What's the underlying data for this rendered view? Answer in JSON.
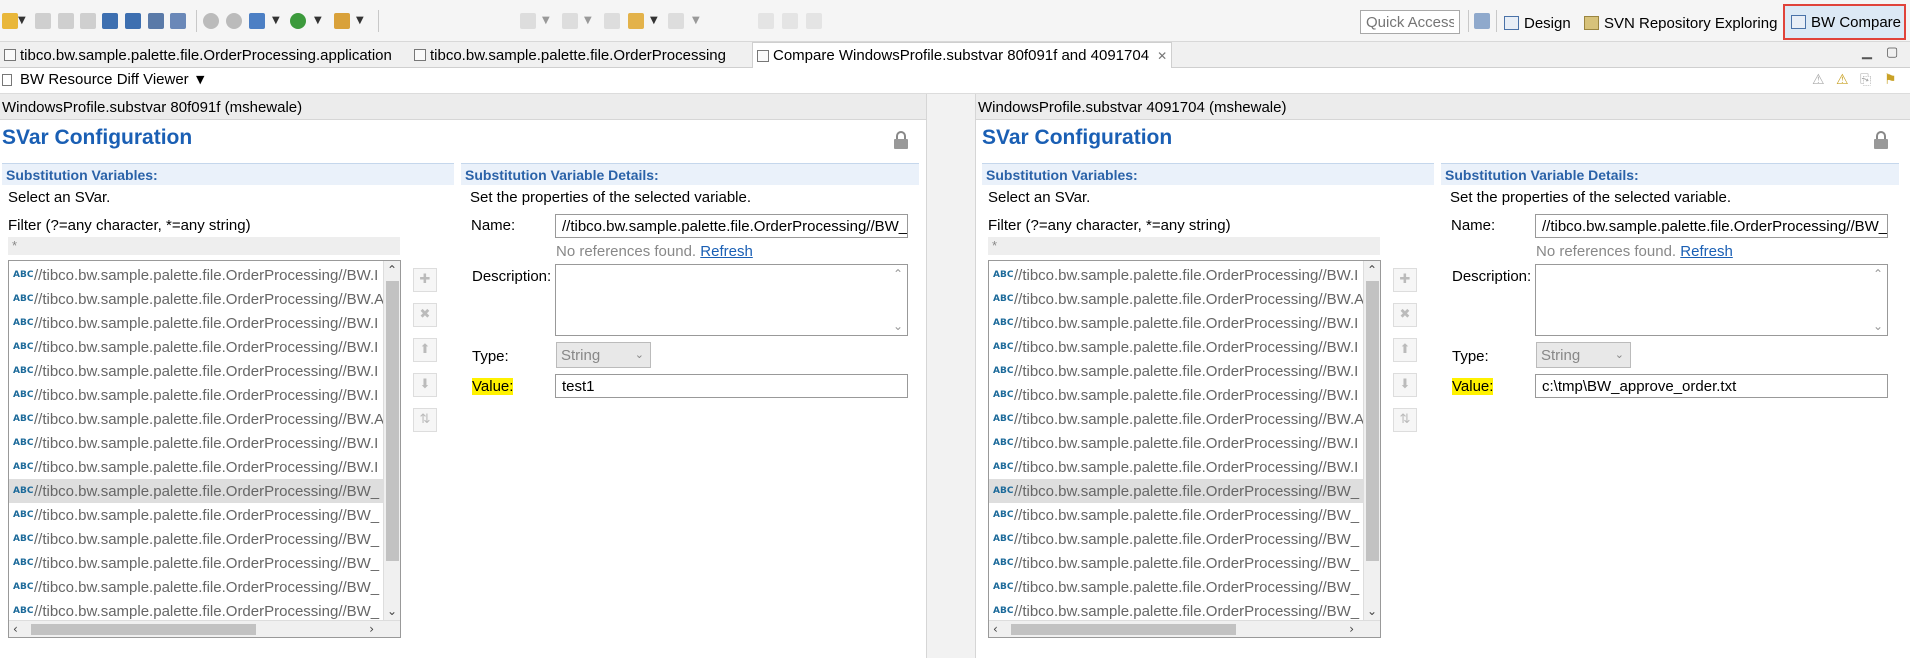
{
  "toolbar": {
    "quick_access_placeholder": "Quick Access",
    "perspectives": [
      {
        "label": "Design",
        "icon": "design-perspective-icon"
      },
      {
        "label": "SVN Repository Exploring",
        "icon": "svn-perspective-icon"
      },
      {
        "label": "BW Compare",
        "icon": "compare-perspective-icon",
        "selected": true
      }
    ],
    "icons": [
      "new-icon",
      "save-icon",
      "save-all-icon",
      "print-icon",
      "new-module-icon",
      "deploy-icon",
      "debug-icon",
      "run-icon",
      "settings-icon",
      "gear-icon",
      "palette-icon",
      "run-app-icon",
      "tools-icon",
      "nav-back-icon",
      "nav-forward-icon"
    ]
  },
  "editor_tabs": [
    {
      "label": "tibco.bw.sample.palette.file.OrderProcessing.application"
    },
    {
      "label": "tibco.bw.sample.palette.file.OrderProcessing"
    },
    {
      "label": "Compare WindowsProfile.substvar 80f091f and 4091704",
      "active": true,
      "close": "✕"
    }
  ],
  "viewer": {
    "title": "BW Resource Diff Viewer"
  },
  "panes": [
    {
      "header": "WindowsProfile.substvar 80f091f (mshewale)",
      "title": "SVar Configuration",
      "subst_vars_heading": "Substitution Variables:",
      "select_hint": "Select an SVar.",
      "filter_label": "Filter (?=any character, *=any string)",
      "filter_value": "*",
      "list": [
        "//tibco.bw.sample.palette.file.OrderProcessing//BW.I",
        "//tibco.bw.sample.palette.file.OrderProcessing//BW.A",
        "//tibco.bw.sample.palette.file.OrderProcessing//BW.I",
        "//tibco.bw.sample.palette.file.OrderProcessing//BW.I",
        "//tibco.bw.sample.palette.file.OrderProcessing//BW.I",
        "//tibco.bw.sample.palette.file.OrderProcessing//BW.I",
        "//tibco.bw.sample.palette.file.OrderProcessing//BW.A",
        "//tibco.bw.sample.palette.file.OrderProcessing//BW.I",
        "//tibco.bw.sample.palette.file.OrderProcessing//BW.I",
        "//tibco.bw.sample.palette.file.OrderProcessing//BW_",
        "//tibco.bw.sample.palette.file.OrderProcessing//BW_",
        "//tibco.bw.sample.palette.file.OrderProcessing//BW_",
        "//tibco.bw.sample.palette.file.OrderProcessing//BW_",
        "//tibco.bw.sample.palette.file.OrderProcessing//BW_",
        "//tibco.bw.sample.palette.file.OrderProcessing//BW_"
      ],
      "selected_index": 9,
      "details_heading": "Substitution Variable Details:",
      "details_hint": "Set the properties of the selected variable.",
      "name_label": "Name:",
      "name_value": "//tibco.bw.sample.palette.file.OrderProcessing//BW_a",
      "no_refs": "No references found.",
      "refresh": "Refresh",
      "description_label": "Description:",
      "type_label": "Type:",
      "type_value": "String",
      "value_label": "Value:",
      "value_value": "test1"
    },
    {
      "header": "WindowsProfile.substvar 4091704 (mshewale)",
      "title": "SVar Configuration",
      "subst_vars_heading": "Substitution Variables:",
      "select_hint": "Select an SVar.",
      "filter_label": "Filter (?=any character, *=any string)",
      "filter_value": "*",
      "list": [
        "//tibco.bw.sample.palette.file.OrderProcessing//BW.I",
        "//tibco.bw.sample.palette.file.OrderProcessing//BW.A",
        "//tibco.bw.sample.palette.file.OrderProcessing//BW.I",
        "//tibco.bw.sample.palette.file.OrderProcessing//BW.I",
        "//tibco.bw.sample.palette.file.OrderProcessing//BW.I",
        "//tibco.bw.sample.palette.file.OrderProcessing//BW.I",
        "//tibco.bw.sample.palette.file.OrderProcessing//BW.A",
        "//tibco.bw.sample.palette.file.OrderProcessing//BW.I",
        "//tibco.bw.sample.palette.file.OrderProcessing//BW.I",
        "//tibco.bw.sample.palette.file.OrderProcessing//BW_",
        "//tibco.bw.sample.palette.file.OrderProcessing//BW_",
        "//tibco.bw.sample.palette.file.OrderProcessing//BW_",
        "//tibco.bw.sample.palette.file.OrderProcessing//BW_",
        "//tibco.bw.sample.palette.file.OrderProcessing//BW_",
        "//tibco.bw.sample.palette.file.OrderProcessing//BW_"
      ],
      "selected_index": 9,
      "details_heading": "Substitution Variable Details:",
      "details_hint": "Set the properties of the selected variable.",
      "name_label": "Name:",
      "name_value": "//tibco.bw.sample.palette.file.OrderProcessing//BW_a",
      "no_refs": "No references found.",
      "refresh": "Refresh",
      "description_label": "Description:",
      "type_label": "Type:",
      "type_value": "String",
      "value_label": "Value:",
      "value_value": "c:\\tmp\\BW_approve_order.txt"
    }
  ],
  "colors": {
    "accent_blue": "#1a5fb4",
    "highlight_yellow": "#fff200",
    "selection_border": "#e0433a"
  }
}
